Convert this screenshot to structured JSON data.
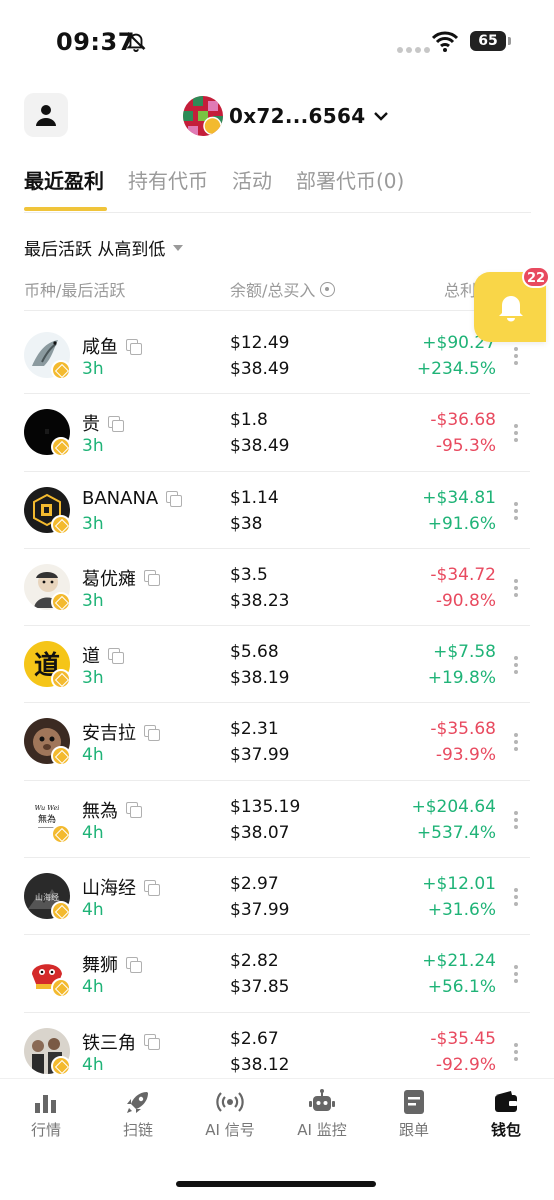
{
  "status_bar": {
    "time": "09:37",
    "battery": "65",
    "icons": [
      "bell-off-icon",
      "signal-dots-icon",
      "wifi-icon",
      "battery-icon"
    ]
  },
  "header": {
    "profile_icon": "person-icon",
    "wallet_address": "0x72...6564",
    "dropdown_icon": "chevron-down-icon"
  },
  "tabs": [
    {
      "label": "最近盈利",
      "active": true
    },
    {
      "label": "持有代币",
      "active": false
    },
    {
      "label": "活动",
      "active": false
    },
    {
      "label": "部署代币(0)",
      "active": false
    }
  ],
  "sort": {
    "label": "最后活跃 从高到低"
  },
  "columns": {
    "coin": "币种/最后活跃",
    "balance": "余额/总买入",
    "profit": "总利"
  },
  "notification": {
    "badge_count": "22",
    "icon": "bell-icon"
  },
  "colors": {
    "accent": "#f0c43a",
    "positive": "#1fb377",
    "negative": "#e84a5f"
  },
  "rows": [
    {
      "name": "咸鱼",
      "age": "3h",
      "balance": "$12.49",
      "bought": "$38.49",
      "pnl": "+$90.27",
      "pct": "+234.5%",
      "sign": "pos"
    },
    {
      "name": "贵",
      "age": "3h",
      "balance": "$1.8",
      "bought": "$38.49",
      "pnl": "-$36.68",
      "pct": "-95.3%",
      "sign": "neg"
    },
    {
      "name": "BANANA",
      "age": "3h",
      "balance": "$1.14",
      "bought": "$38",
      "pnl": "+$34.81",
      "pct": "+91.6%",
      "sign": "pos"
    },
    {
      "name": "葛优瘫",
      "age": "3h",
      "balance": "$3.5",
      "bought": "$38.23",
      "pnl": "-$34.72",
      "pct": "-90.8%",
      "sign": "neg"
    },
    {
      "name": "道",
      "age": "3h",
      "balance": "$5.68",
      "bought": "$38.19",
      "pnl": "+$7.58",
      "pct": "+19.8%",
      "sign": "pos"
    },
    {
      "name": "安吉拉",
      "age": "4h",
      "balance": "$2.31",
      "bought": "$37.99",
      "pnl": "-$35.68",
      "pct": "-93.9%",
      "sign": "neg"
    },
    {
      "name": "無為",
      "age": "4h",
      "balance": "$135.19",
      "bought": "$38.07",
      "pnl": "+$204.64",
      "pct": "+537.4%",
      "sign": "pos"
    },
    {
      "name": "山海经",
      "age": "4h",
      "balance": "$2.97",
      "bought": "$37.99",
      "pnl": "+$12.01",
      "pct": "+31.6%",
      "sign": "pos"
    },
    {
      "name": "舞狮",
      "age": "4h",
      "balance": "$2.82",
      "bought": "$37.85",
      "pnl": "+$21.24",
      "pct": "+56.1%",
      "sign": "pos"
    },
    {
      "name": "铁三角",
      "age": "4h",
      "balance": "$2.67",
      "bought": "$38.12",
      "pnl": "-$35.45",
      "pct": "-92.9%",
      "sign": "neg"
    }
  ],
  "coin_logo_texts": {
    "道": "道",
    "無為": "Wu Wei 無為",
    "山海经": "山海经"
  },
  "bottom_nav": [
    {
      "label": "行情",
      "icon": "bar-chart-icon",
      "active": false
    },
    {
      "label": "扫链",
      "icon": "rocket-icon",
      "active": false
    },
    {
      "label": "AI 信号",
      "icon": "signal-broadcast-icon",
      "active": false
    },
    {
      "label": "AI 监控",
      "icon": "robot-icon",
      "active": false
    },
    {
      "label": "跟单",
      "icon": "document-icon",
      "active": false
    },
    {
      "label": "钱包",
      "icon": "wallet-icon",
      "active": true
    }
  ]
}
